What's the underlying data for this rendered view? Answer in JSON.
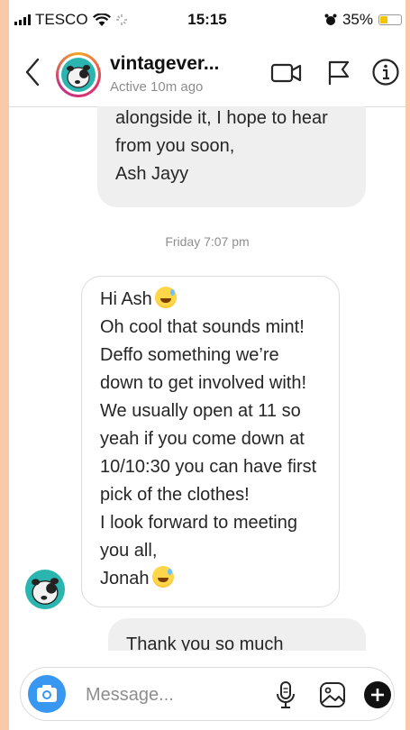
{
  "status_bar": {
    "carrier": "TESCO",
    "time": "15:15",
    "battery": "35%",
    "battery_level": 0.35
  },
  "header": {
    "username": "vintagever...",
    "status": "Active 10m ago"
  },
  "messages": {
    "outgoing_top": [
      "alongside it, I hope to hear",
      "from you soon,",
      "Ash Jayy"
    ],
    "timestamp": "Friday 7:07 pm",
    "incoming_greeting": "Hi Ash",
    "incoming": [
      "Oh cool that sounds mint!",
      "Deffo something we’re",
      "down to get involved with!",
      "We usually open at 11 so",
      "yeah if you come down at",
      "10/10:30 you can have first",
      "pick of the clothes!",
      "I look forward to meeting",
      "you all,"
    ],
    "incoming_signoff": "Jonah",
    "outgoing_bottom": "Thank you so much"
  },
  "composer": {
    "placeholder": "Message..."
  },
  "colors": {
    "accent": "#3897f0",
    "avatar_bg": "#2bb5b0",
    "bubble_grey": "#efefef"
  }
}
